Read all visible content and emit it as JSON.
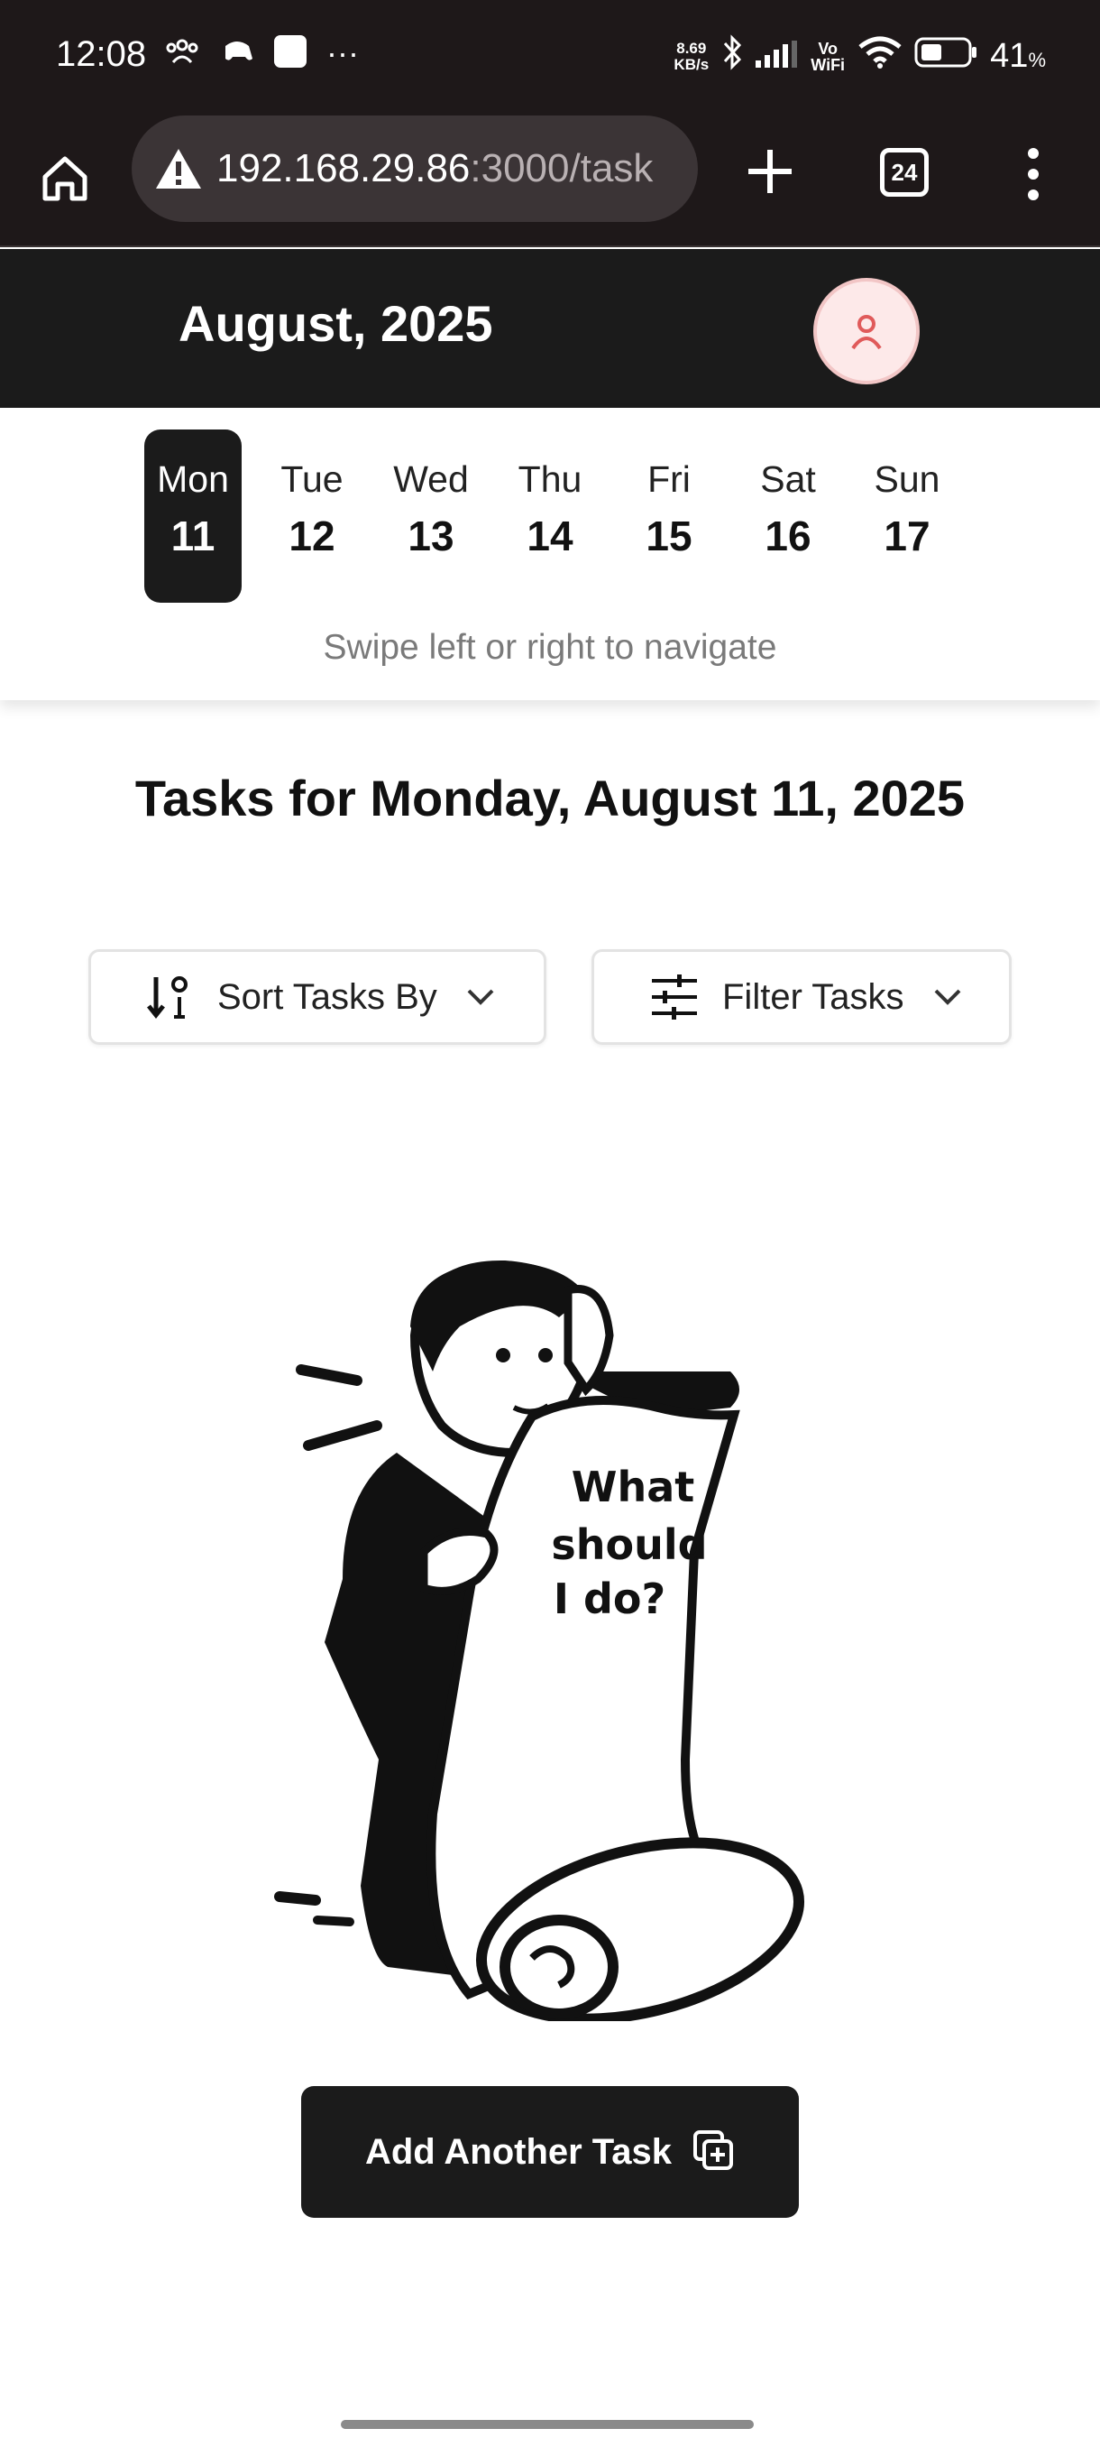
{
  "status_bar": {
    "time": "12:08",
    "more": "···",
    "speed_value": "8.69",
    "speed_unit": "KB/s",
    "volte": "Vo WiFi",
    "battery_percent": "41",
    "battery_unit": "%"
  },
  "browser": {
    "url_host": "192.168.29.86",
    "url_rest": ":3000/task",
    "tabs_count": "24",
    "icons": [
      "home-icon",
      "warning-icon",
      "plus-icon",
      "tabs-icon",
      "more-vert-icon"
    ]
  },
  "header": {
    "month_title": "August, 2025",
    "avatar_icon": "user-icon",
    "accent_color": "#e05a5a"
  },
  "week": {
    "days": [
      {
        "name": "Mon",
        "num": "11",
        "active": true
      },
      {
        "name": "Tue",
        "num": "12",
        "active": false
      },
      {
        "name": "Wed",
        "num": "13",
        "active": false
      },
      {
        "name": "Thu",
        "num": "14",
        "active": false
      },
      {
        "name": "Fri",
        "num": "15",
        "active": false
      },
      {
        "name": "Sat",
        "num": "16",
        "active": false
      },
      {
        "name": "Sun",
        "num": "17",
        "active": false
      }
    ],
    "swipe_hint": "Swipe left or right to navigate"
  },
  "main": {
    "heading": "Tasks for Monday, August 11, 2025",
    "sort_label": "Sort Tasks By",
    "filter_label": "Filter Tasks",
    "illustration_text": [
      "What",
      "should",
      "I do?"
    ],
    "add_button_label": "Add Another Task"
  }
}
